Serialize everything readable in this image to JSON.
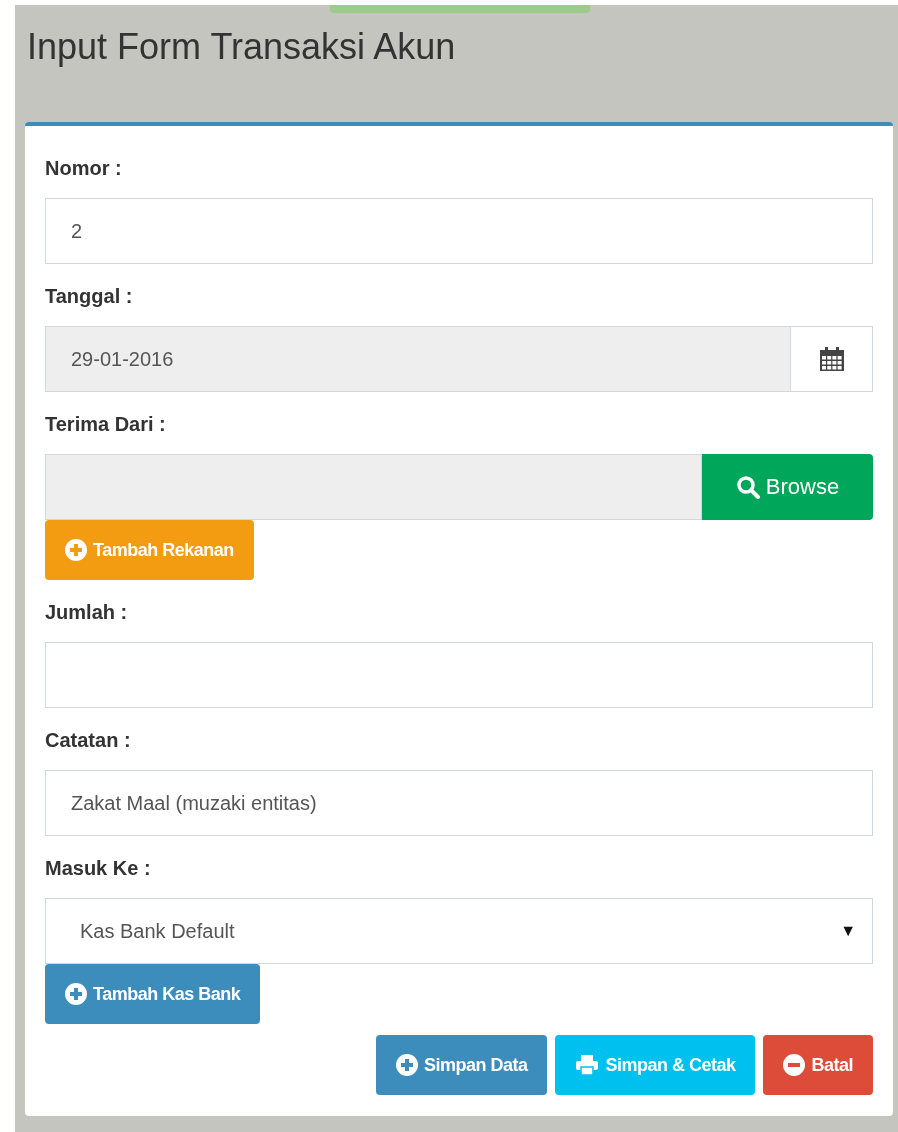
{
  "page": {
    "title": "Input Form Transaksi Akun"
  },
  "fields": [
    {
      "label": "Nomor :",
      "kind": "text",
      "value": "2",
      "readonly": false
    },
    {
      "label": "Tanggal :",
      "kind": "date",
      "value": "29-01-2016",
      "readonly": true
    },
    {
      "label": "Terima Dari :",
      "kind": "browse",
      "readonly": true,
      "addon": "Browse",
      "add_button": {
        "label": "Tambah Rekanan",
        "kind": "warning"
      }
    },
    {
      "label": "Jumlah :",
      "kind": "text",
      "readonly": false
    },
    {
      "label": "Catatan :",
      "kind": "text",
      "value": "Zakat Maal (muzaki entitas)",
      "readonly": false
    },
    {
      "label": "Masuk Ke :",
      "kind": "select",
      "value": "Kas Bank Default",
      "caret": "▼",
      "readonly": false,
      "add_button": {
        "label": "Tambah Kas Bank",
        "kind": "primary"
      }
    }
  ],
  "actions": [
    {
      "label": "Simpan Data",
      "kind": "save"
    },
    {
      "label": "Simpan & Cetak",
      "kind": "print"
    },
    {
      "label": "Batal",
      "kind": "cancel"
    }
  ]
}
